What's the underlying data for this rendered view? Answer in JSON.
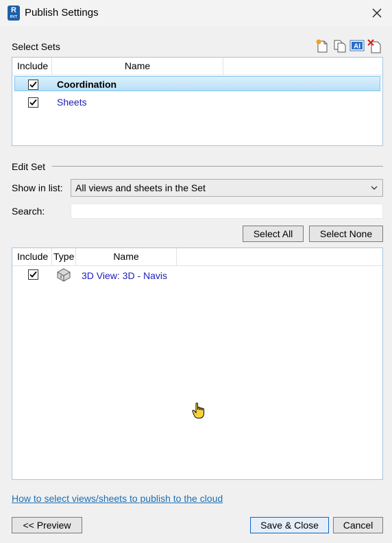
{
  "window": {
    "title": "Publish Settings",
    "app_icon_letter": "R",
    "app_icon_sub": "RVT"
  },
  "select_sets": {
    "label": "Select Sets",
    "toolbar_icons": [
      "new-set-icon",
      "duplicate-set-icon",
      "rename-set-icon",
      "delete-set-icon"
    ],
    "columns": [
      "Include",
      "Name"
    ],
    "rows": [
      {
        "checked": true,
        "name": "Coordination",
        "selected": true
      },
      {
        "checked": true,
        "name": "Sheets",
        "selected": false
      }
    ]
  },
  "edit_set": {
    "label": "Edit Set",
    "show_in_list_label": "Show in list:",
    "show_in_list_value": "All views and sheets in the Set",
    "search_label": "Search:",
    "search_value": "",
    "select_all": "Select All",
    "select_none": "Select None",
    "columns": [
      "Include",
      "Type",
      "Name"
    ],
    "rows": [
      {
        "checked": true,
        "type_icon": "3d-view-icon",
        "name": "3D View: 3D - Navis"
      }
    ]
  },
  "footer": {
    "help_link": "How to select views/sheets to publish to the cloud",
    "preview": "<< Preview",
    "save_close": "Save & Close",
    "cancel": "Cancel"
  },
  "colors": {
    "selection": "#b8e0f8",
    "link": "#1d1db8",
    "help_link": "#1a6fb5"
  }
}
